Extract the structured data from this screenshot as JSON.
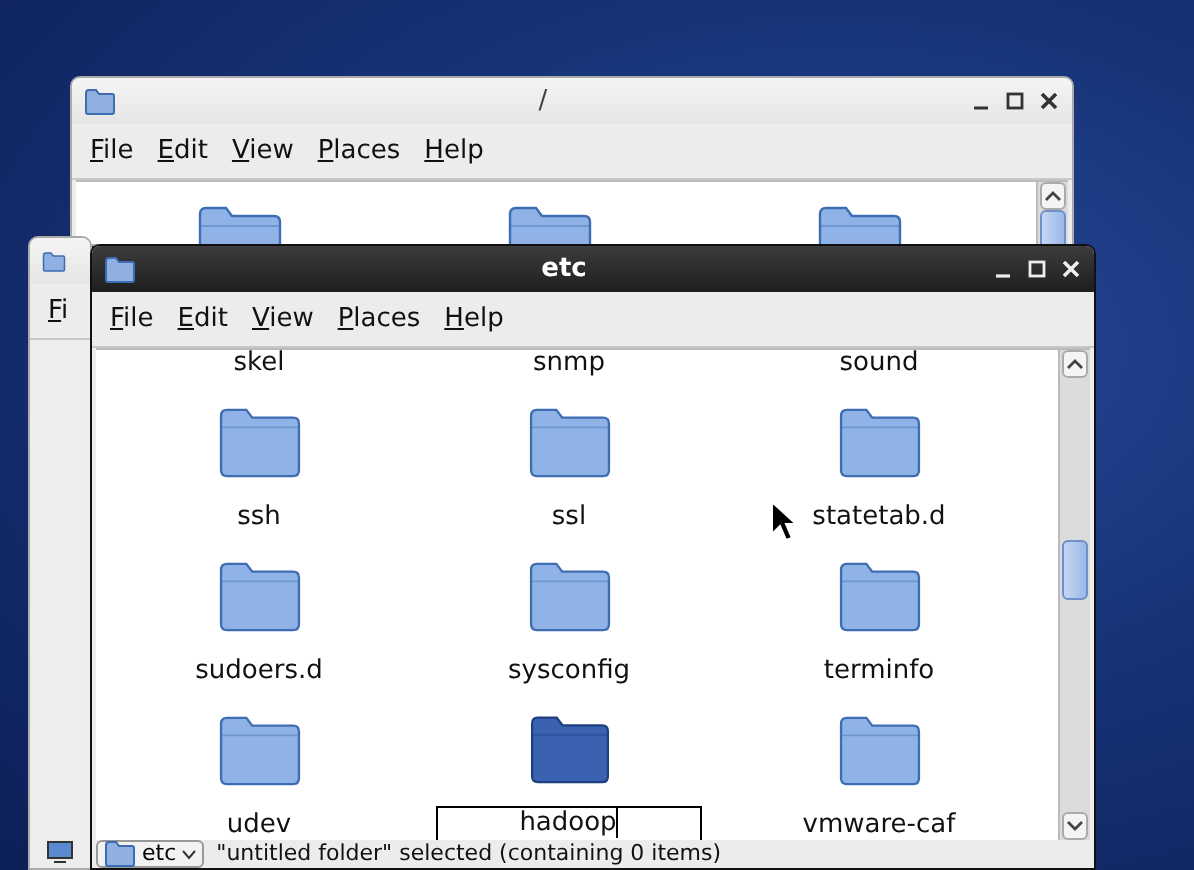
{
  "windows": [
    {
      "kind": "back",
      "title": "/",
      "active": false,
      "menu": [
        "File",
        "Edit",
        "View",
        "Places",
        "Help"
      ]
    },
    {
      "kind": "side",
      "active": false,
      "menu": [
        "Fi"
      ]
    },
    {
      "kind": "front",
      "title": "etc",
      "active": true,
      "menu": [
        "File",
        "Edit",
        "View",
        "Places",
        "Help"
      ],
      "items": [
        {
          "name": "skel",
          "selected": false,
          "editing": false
        },
        {
          "name": "snmp",
          "selected": false,
          "editing": false
        },
        {
          "name": "sound",
          "selected": false,
          "editing": false
        },
        {
          "name": "ssh",
          "selected": false,
          "editing": false
        },
        {
          "name": "ssl",
          "selected": false,
          "editing": false
        },
        {
          "name": "statetab.d",
          "selected": false,
          "editing": false
        },
        {
          "name": "sudoers.d",
          "selected": false,
          "editing": false
        },
        {
          "name": "sysconfig",
          "selected": false,
          "editing": false
        },
        {
          "name": "terminfo",
          "selected": false,
          "editing": false
        },
        {
          "name": "udev",
          "selected": false,
          "editing": false
        },
        {
          "name": "hadoop",
          "selected": true,
          "editing": true
        },
        {
          "name": "vmware-caf",
          "selected": false,
          "editing": false
        }
      ],
      "status_bar": {
        "location": "etc",
        "text": "\"untitled folder\" selected (containing 0 items)"
      }
    }
  ]
}
